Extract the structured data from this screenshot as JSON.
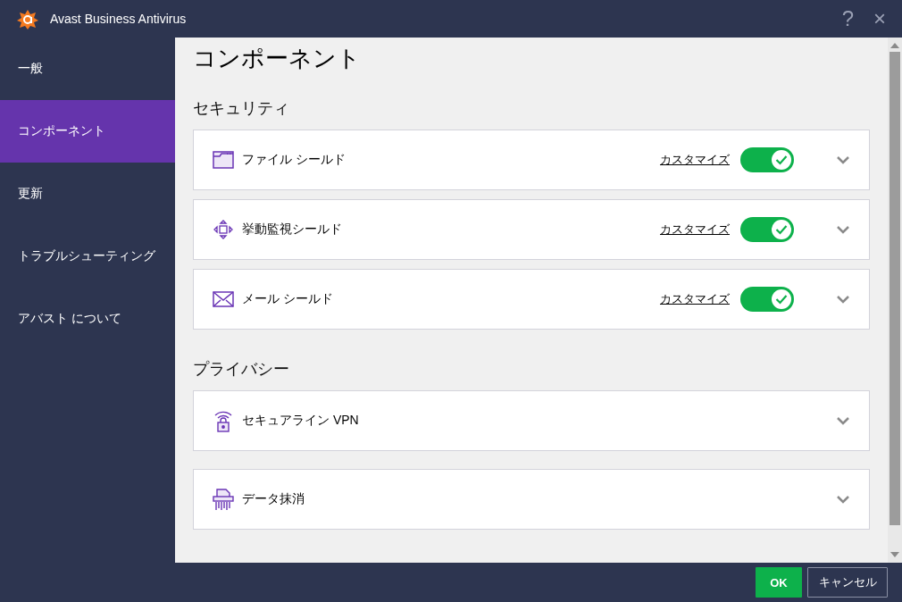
{
  "window": {
    "title": "Avast Business Antivirus",
    "help": "?",
    "close": "×"
  },
  "sidebar": {
    "items": [
      {
        "label": "一般",
        "selected": false
      },
      {
        "label": "コンポーネント",
        "selected": true
      },
      {
        "label": "更新",
        "selected": false
      },
      {
        "label": "トラブルシューティング",
        "selected": false
      },
      {
        "label": "アバスト について",
        "selected": false
      }
    ]
  },
  "page_title": "コンポーネント",
  "sections": [
    {
      "title": "セキュリティ",
      "components": [
        {
          "name": "ファイル シールド",
          "customize": "カスタマイズ",
          "on": true
        },
        {
          "name": "挙動監視シールド",
          "customize": "カスタマイズ",
          "on": true
        },
        {
          "name": "メール シールド",
          "customize": "カスタマイズ",
          "on": true
        }
      ]
    },
    {
      "title": "プライバシー",
      "components": [
        {
          "name": "セキュアライン VPN"
        },
        {
          "name": "データ抹消"
        }
      ]
    }
  ],
  "buttons": [
    {
      "label": "OK",
      "kind": "primary"
    },
    {
      "label": "キャンセル",
      "kind": "secondary"
    }
  ]
}
